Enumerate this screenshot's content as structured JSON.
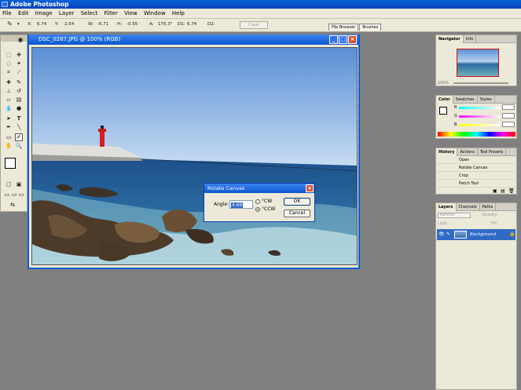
{
  "app": {
    "title": "Adobe Photoshop"
  },
  "menu": [
    "File",
    "Edit",
    "Image",
    "Layer",
    "Select",
    "Filter",
    "View",
    "Window",
    "Help"
  ],
  "options_bar": {
    "x": "X:",
    "x_val": "6.74",
    "y": "Y:",
    "y_val": "2.54",
    "w": "W:",
    "w_val": "-6.71",
    "h": "H:",
    "h_val": "-0.55",
    "a": "A:",
    "a_val": "175.3°",
    "d1": "D1:",
    "d1_val": "6.74",
    "d2": "D2:",
    "clear_label": "Clear",
    "well_tabs": [
      "File Browser",
      "Brushes"
    ]
  },
  "document": {
    "title": "DSC_0287.JPG @ 100% (RGB)"
  },
  "dialog": {
    "title": "Rotate Canvas",
    "angle_label": "Angle:",
    "angle_value": "4.69",
    "cw_label": "°CW",
    "ccw_label": "°CCW",
    "ok_label": "OK",
    "cancel_label": "Cancel"
  },
  "navigator": {
    "tabs": [
      "Navigator",
      "Info"
    ],
    "zoom": "100%"
  },
  "color": {
    "tabs": [
      "Color",
      "Swatches",
      "Styles"
    ],
    "r_label": "R",
    "g_label": "G",
    "b_label": "B",
    "r_val": "",
    "g_val": "",
    "b_val": ""
  },
  "history": {
    "tabs": [
      "History",
      "Actions",
      "Tool Presets"
    ],
    "items": [
      "Open",
      "Rotate Canvas",
      "Crop",
      "Patch Tool"
    ]
  },
  "layers": {
    "tabs": [
      "Layers",
      "Channels",
      "Paths"
    ],
    "blend": "Normal",
    "opacity_label": "Opacity:",
    "lock_label": "Lock:",
    "fill_label": "Fill:",
    "layer_name": "Background"
  },
  "colors": {
    "accent": "#0a5fd8",
    "panel_bg": "#ece9d8",
    "workspace": "#808080"
  }
}
